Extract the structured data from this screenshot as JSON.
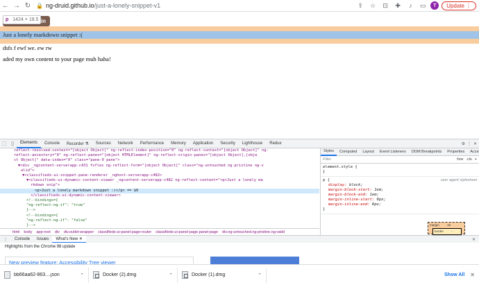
{
  "browser": {
    "url_host": "ng-druid.github.io",
    "url_path": "/just-a-lonely-snippet-v1",
    "avatar_initial": "T",
    "update_label": "Update"
  },
  "page": {
    "login_label": "Login",
    "tooltip_tag": "p",
    "tooltip_size": "1424 × 18.5",
    "snippet_text": "Just a lonely markdown snippet :(",
    "text_line_1": "dsfs f ewf we. ew rw",
    "text_line_2": "aded my own content to your page muh haha!"
  },
  "devtools": {
    "tabs": [
      "Elements",
      "Console",
      "Recorder ⚗",
      "Sources",
      "Network",
      "Performance",
      "Memory",
      "Application",
      "Security",
      "Lighthouse",
      "Redux"
    ],
    "active_tab": "Elements",
    "dom_lines": [
      "reflect-resolved-context=\"[object Object]\" ng-reflect-index-position=\"0\" ng-reflect-context=\"[object Object]\" ng-",
      "reflect-ancestory=\"0\" ng-reflect-panes=\"[object HTMLElement]\" ng-reflect-origin-panes=\"[object Object],[obje",
      "ct Object]\" data-index=\"0\" class=\"pane-0 pane\">",
      "▼<div _ngcontent-serverapp-c431 fxflex ng-reflect-form=\"[object Object]\" class=\"ng-untouched ng-pristine ng-v",
      "alid\">",
      "▼<classifieds-ui-snippet-pane-renderer _nghost-serverapp-c482>",
      "▼<classifieds-ui-dynamic-content-viewer _ngcontent-serverapp-c482 ng-reflect-content=\"<p>Just a lonely ma",
      "rkdown snip\">",
      "<p>Just a lonely markdown snippet :(</p> == $0",
      "</classifieds-ui-dynamic-content-viewer>",
      "<!--bindings={",
      "  \"ng-reflect-ng-if\": \"true\"",
      "}-->",
      "<!--bindings={",
      "  \"ng-reflect-ng-if\": \"false\"",
      "}-->"
    ],
    "breadcrumbs": [
      "html",
      "body",
      "app-root",
      "div",
      "div.outlet-wrapper",
      "classifieds-ui-panel-page-router",
      "classifieds-ui-panel-page.panel-page",
      "div.ng-untouched.ng-pristine.ng-valid"
    ],
    "styles_tabs": [
      "Styles",
      "Computed",
      "Layout",
      "Event Listeners",
      "DOM Breakpoints",
      "Properties",
      "Accessibility"
    ],
    "filter_placeholder": "Filter",
    "filter_hov": ":hov",
    "filter_cls": ".cls",
    "element_style_selector": "element.style {",
    "element_style_close": "}",
    "p_selector": "p {",
    "p_source": "user agent stylesheet",
    "p_props": [
      {
        "name": "display",
        "value": "block;"
      },
      {
        "name": "margin-block-start",
        "value": "1em;"
      },
      {
        "name": "margin-block-end",
        "value": "1em;"
      },
      {
        "name": "margin-inline-start",
        "value": "0px;"
      },
      {
        "name": "margin-inline-end",
        "value": "0px;"
      }
    ],
    "p_close": "}",
    "boxmodel_margin_label": "margin",
    "boxmodel_margin_value": "16",
    "boxmodel_border_label": "border",
    "boxmodel_border_value": "-"
  },
  "drawer": {
    "tabs": [
      "Console",
      "Issues",
      "What's New ✕"
    ],
    "active_tab": "What's New ✕",
    "highlights": "Highlights from the Chrome 98 update",
    "card_title": "New preview feature: Accessibility Tree viewer"
  },
  "downloads": {
    "items": [
      "bb66aa62-863....json",
      "Docker (2).dmg",
      "Docker (1).dmg"
    ],
    "show_all": "Show All"
  }
}
